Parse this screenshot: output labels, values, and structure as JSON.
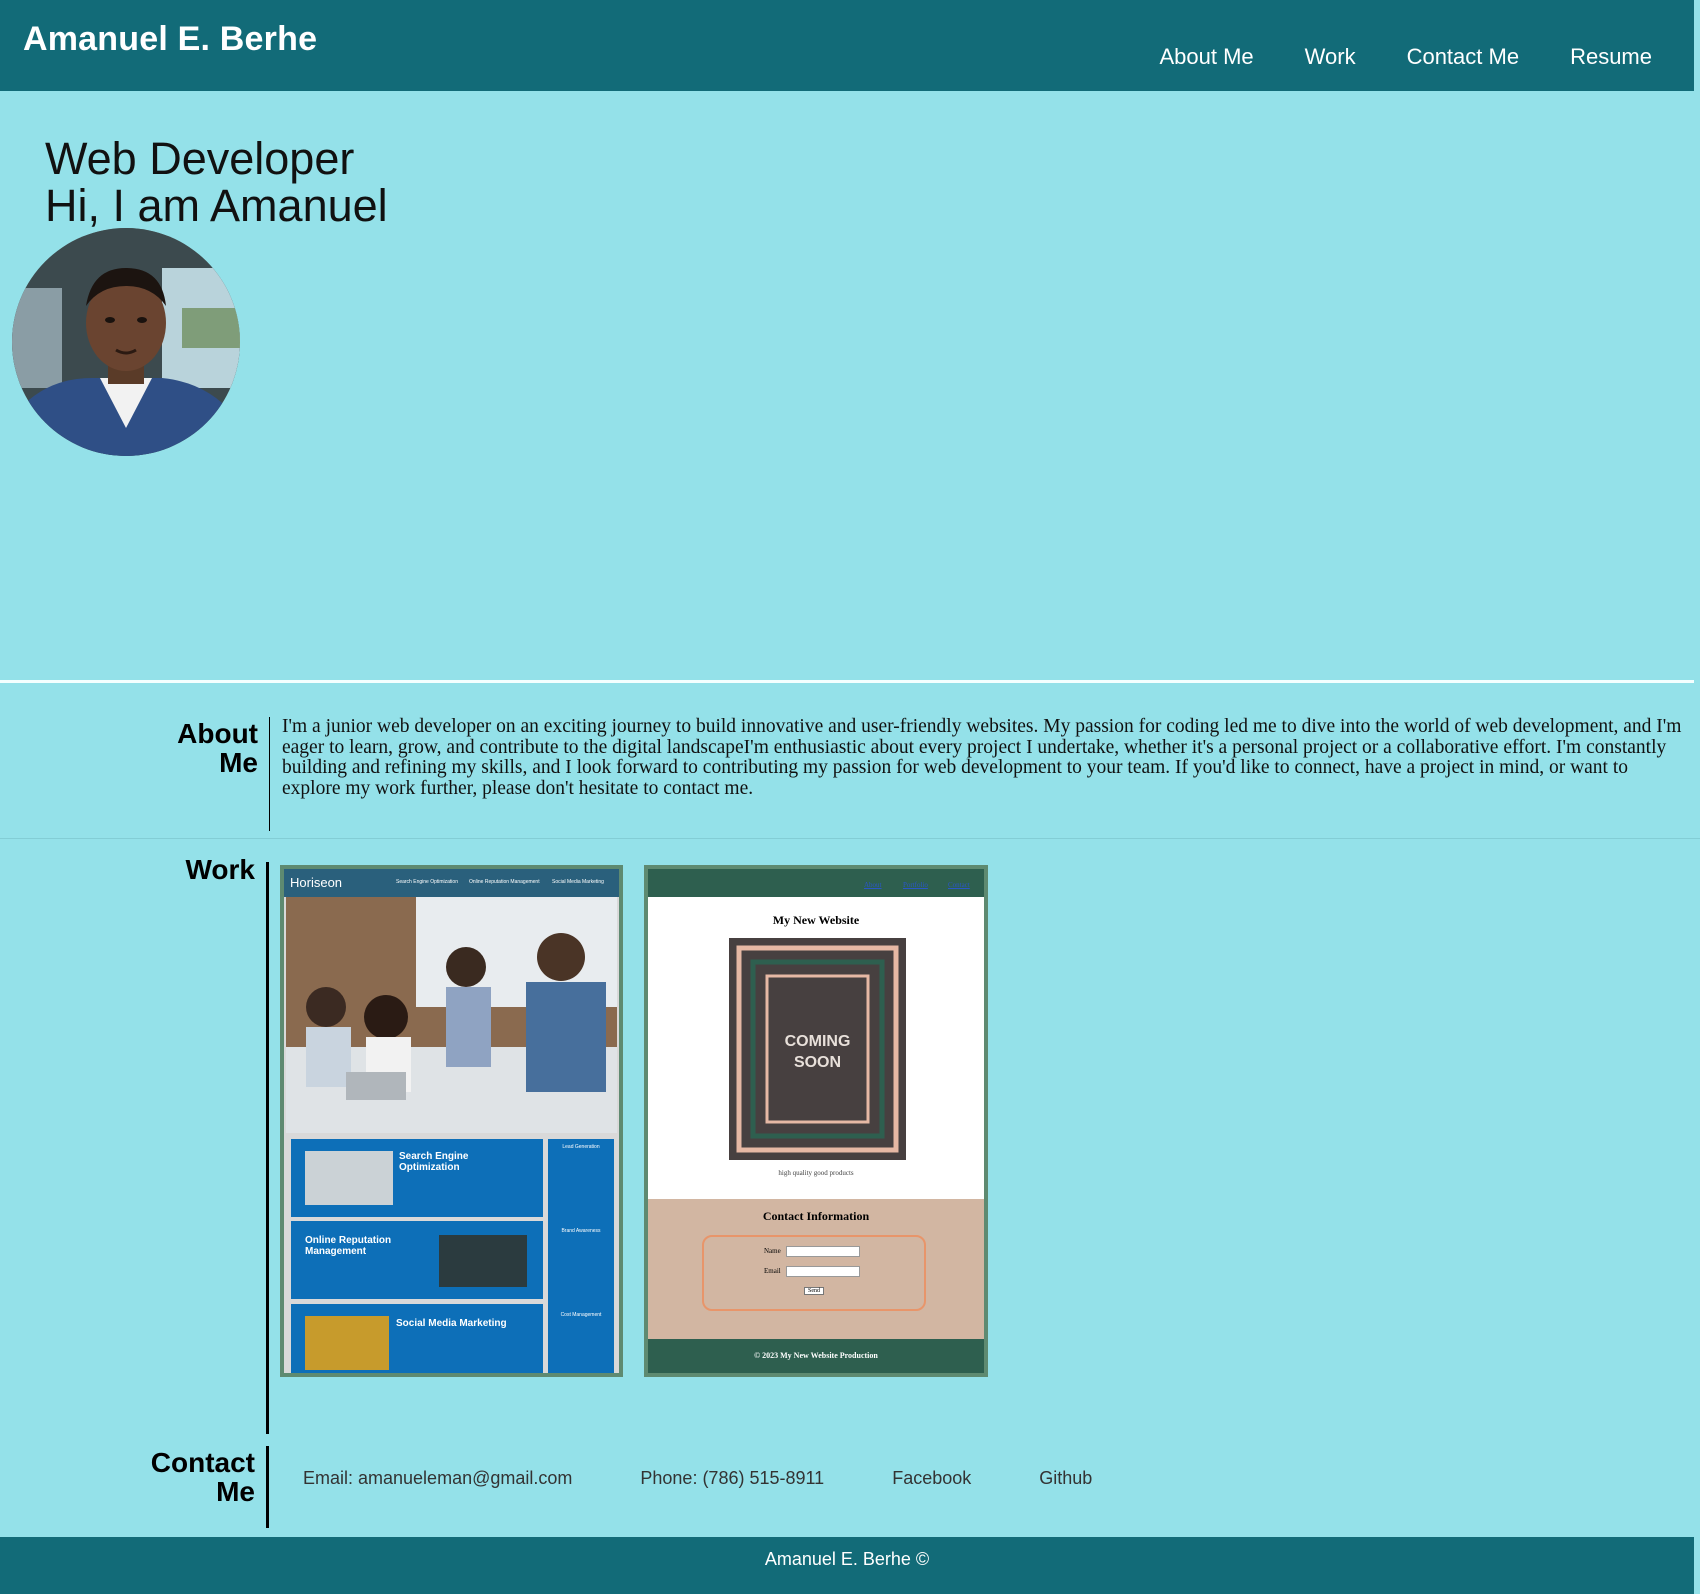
{
  "header": {
    "brand": "Amanuel E. Berhe",
    "nav": [
      "About Me",
      "Work",
      "Contact Me",
      "Resume"
    ]
  },
  "hero": {
    "line1": "Web Developer",
    "line2": "Hi, I am Amanuel"
  },
  "about": {
    "label": "About Me",
    "text": "I'm a junior web developer on an exciting journey to build innovative and user-friendly websites. My passion for coding led me to dive into the world of web development, and I'm eager to learn, grow, and contribute to the digital landscapeI'm enthusiastic about every project I undertake, whether it's a personal project or a collaborative effort. I'm constantly building and refining my skills, and I look forward to contributing my passion for web development to your team. If you'd like to connect, have a project in mind, or want to explore my work further, please don't hesitate to contact me."
  },
  "work": {
    "label": "Work",
    "project1": {
      "logo": "Horiseon",
      "nav": [
        "Search Engine Optimization",
        "Online Reputation Management",
        "Social Media Marketing"
      ],
      "cards": [
        "Search Engine Optimization",
        "Online Reputation Management",
        "Social Media Marketing"
      ],
      "side": [
        "Lead Generation",
        "Brand Awareness",
        "Cost Management"
      ]
    },
    "project2": {
      "links": [
        "About",
        "Portfolio",
        "Contact"
      ],
      "title": "My New Website",
      "badge": "COMING SOON",
      "caption": "high quality good products",
      "contact_title": "Contact Information",
      "name_label": "Name",
      "email_label": "Email",
      "send": "Send",
      "footer": "© 2023 My New Website Production"
    }
  },
  "contact": {
    "label": "Contact Me",
    "email": "Email: amanueleman@gmail.com",
    "phone": "Phone: (786) 515-8911",
    "facebook": "Facebook",
    "github": "Github"
  },
  "footer": {
    "text": "Amanuel E. Berhe ©"
  },
  "colors": {
    "header": "#126b78",
    "background": "#94e1e9",
    "card_border": "#5e8a71"
  }
}
